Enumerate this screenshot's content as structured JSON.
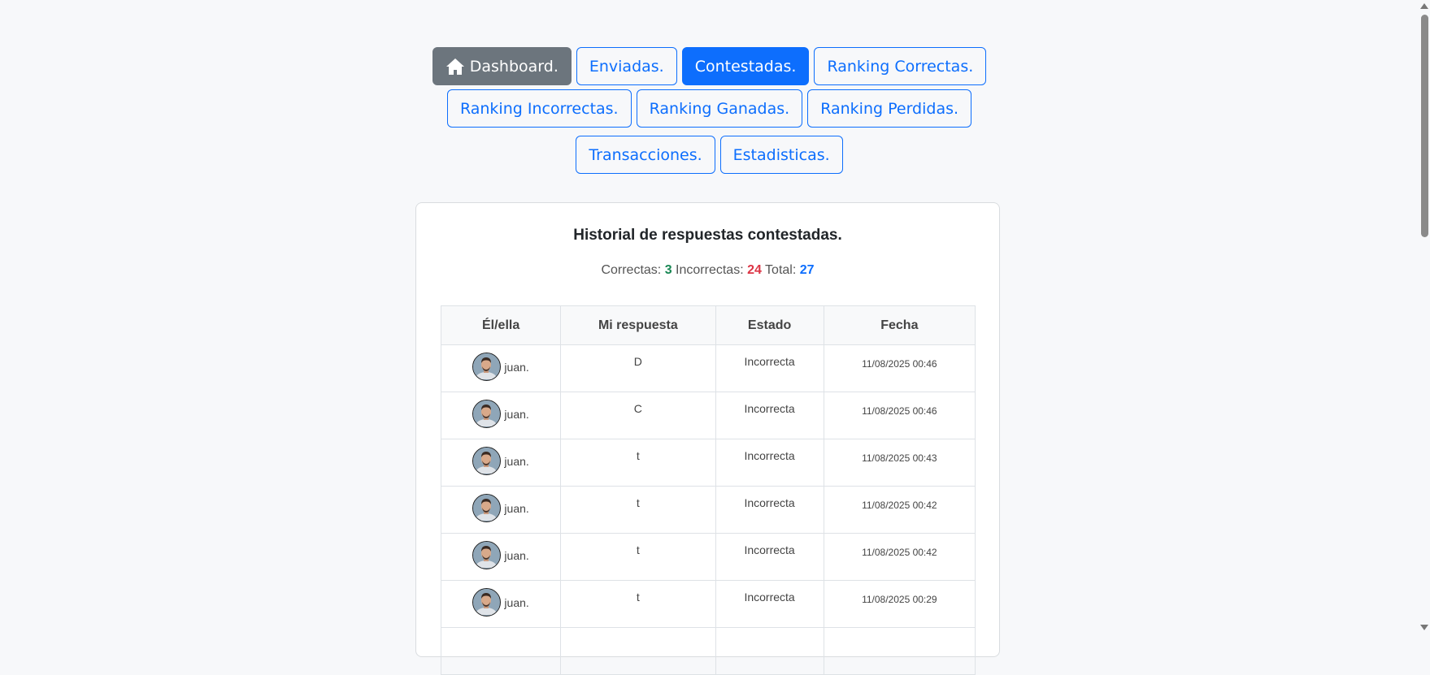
{
  "nav": {
    "dashboard": "Dashboard.",
    "enviadas": "Enviadas.",
    "contestadas": "Contestadas.",
    "ranking_correctas": "Ranking Correctas.",
    "ranking_incorrectas": "Ranking Incorrectas.",
    "ranking_ganadas": "Ranking Ganadas.",
    "ranking_perdidas": "Ranking Perdidas.",
    "transacciones": "Transacciones.",
    "estadisticas": "Estadisticas."
  },
  "colors": {
    "primary": "#0d6efd",
    "secondary": "#6c757d",
    "success": "#198754",
    "danger": "#dc3545"
  },
  "card": {
    "title": "Historial de respuestas contestadas.",
    "summary": {
      "correctas_label": "Correctas:",
      "correctas": "3",
      "incorrectas_label": "Incorrectas:",
      "incorrectas": "24",
      "total_label": "Total:",
      "total": "27"
    }
  },
  "table": {
    "headers": [
      "Él/ella",
      "Mi respuesta",
      "Estado",
      "Fecha"
    ],
    "rows": [
      {
        "user": "juan.",
        "respuesta": "D",
        "estado": "Incorrecta",
        "fecha": "11/08/2025 00:46"
      },
      {
        "user": "juan.",
        "respuesta": "C",
        "estado": "Incorrecta",
        "fecha": "11/08/2025 00:46"
      },
      {
        "user": "juan.",
        "respuesta": "t",
        "estado": "Incorrecta",
        "fecha": "11/08/2025 00:43"
      },
      {
        "user": "juan.",
        "respuesta": "t",
        "estado": "Incorrecta",
        "fecha": "11/08/2025 00:42"
      },
      {
        "user": "juan.",
        "respuesta": "t",
        "estado": "Incorrecta",
        "fecha": "11/08/2025 00:42"
      },
      {
        "user": "juan.",
        "respuesta": "t",
        "estado": "Incorrecta",
        "fecha": "11/08/2025 00:29"
      },
      {
        "user": "",
        "respuesta": "",
        "estado": "",
        "fecha": ""
      }
    ]
  }
}
